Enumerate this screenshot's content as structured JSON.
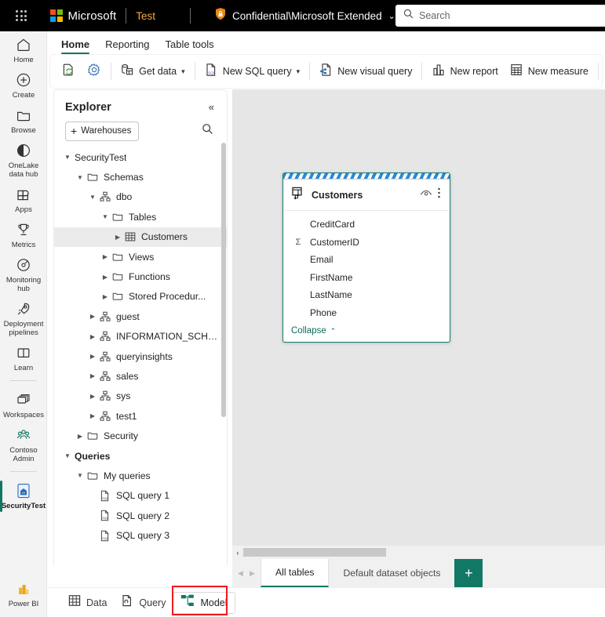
{
  "topbar": {
    "waffle_label": "App launcher",
    "brand": "Microsoft",
    "app_name": "Test",
    "sensitivity_label": "Confidential\\Microsoft Extended",
    "sensitivity_caret": "⌄",
    "search_placeholder": "Search"
  },
  "rail": {
    "items": [
      {
        "label": "Home",
        "icon": "home-icon"
      },
      {
        "label": "Create",
        "icon": "plus-circle-icon"
      },
      {
        "label": "Browse",
        "icon": "folder-icon"
      },
      {
        "label": "OneLake\ndata hub",
        "icon": "onelake-icon"
      },
      {
        "label": "Apps",
        "icon": "apps-icon"
      },
      {
        "label": "Metrics",
        "icon": "trophy-icon"
      },
      {
        "label": "Monitoring\nhub",
        "icon": "monitoring-icon"
      },
      {
        "label": "Deployment\npipelines",
        "icon": "rocket-icon"
      },
      {
        "label": "Learn",
        "icon": "book-icon"
      },
      {
        "label": "Workspaces",
        "icon": "workspaces-icon"
      },
      {
        "label": "Contoso\nAdmin",
        "icon": "people-icon"
      },
      {
        "label": "SecurityTest",
        "icon": "warehouse-icon"
      }
    ],
    "selected": "SecurityTest",
    "footer": {
      "label": "Power BI",
      "icon": "powerbi-icon"
    }
  },
  "ribbon": {
    "tabs": [
      {
        "label": "Home",
        "active": true
      },
      {
        "label": "Reporting",
        "active": false
      },
      {
        "label": "Table tools",
        "active": false
      }
    ],
    "buttons": [
      {
        "label": "",
        "icon": "refresh-page-icon",
        "caret": false
      },
      {
        "label": "",
        "icon": "gear-icon",
        "caret": false
      },
      {
        "label": "Get data",
        "icon": "get-data-icon",
        "caret": true
      },
      {
        "label": "New SQL query",
        "icon": "sql-file-icon",
        "caret": true
      },
      {
        "label": "New visual query",
        "icon": "visual-query-icon",
        "caret": false
      },
      {
        "label": "New report",
        "icon": "report-chart-icon",
        "caret": false
      },
      {
        "label": "New measure",
        "icon": "measure-calculator-icon",
        "caret": false
      }
    ]
  },
  "explorer": {
    "title": "Explorer",
    "collapse_icon": "«",
    "warehouses_button": "Warehouses",
    "warehouses_plus": "+",
    "search_icon": "search-icon",
    "tree": [
      {
        "label": "SecurityTest",
        "indent": 0,
        "chevron": "down",
        "icon": "none",
        "bold": false,
        "selected": false
      },
      {
        "label": "Schemas",
        "indent": 1,
        "chevron": "down",
        "icon": "folder",
        "bold": false,
        "selected": false
      },
      {
        "label": "dbo",
        "indent": 2,
        "chevron": "down",
        "icon": "schema",
        "bold": false,
        "selected": false
      },
      {
        "label": "Tables",
        "indent": 3,
        "chevron": "down",
        "icon": "folder",
        "bold": false,
        "selected": false
      },
      {
        "label": "Customers",
        "indent": 4,
        "chevron": "right",
        "icon": "table",
        "bold": false,
        "selected": true
      },
      {
        "label": "Views",
        "indent": 3,
        "chevron": "right",
        "icon": "folder",
        "bold": false,
        "selected": false
      },
      {
        "label": "Functions",
        "indent": 3,
        "chevron": "right",
        "icon": "folder",
        "bold": false,
        "selected": false
      },
      {
        "label": "Stored Procedur...",
        "indent": 3,
        "chevron": "right",
        "icon": "folder",
        "bold": false,
        "selected": false
      },
      {
        "label": "guest",
        "indent": 2,
        "chevron": "right",
        "icon": "schema",
        "bold": false,
        "selected": false
      },
      {
        "label": "INFORMATION_SCHE...",
        "indent": 2,
        "chevron": "right",
        "icon": "schema",
        "bold": false,
        "selected": false
      },
      {
        "label": "queryinsights",
        "indent": 2,
        "chevron": "right",
        "icon": "schema",
        "bold": false,
        "selected": false
      },
      {
        "label": "sales",
        "indent": 2,
        "chevron": "right",
        "icon": "schema",
        "bold": false,
        "selected": false
      },
      {
        "label": "sys",
        "indent": 2,
        "chevron": "right",
        "icon": "schema",
        "bold": false,
        "selected": false
      },
      {
        "label": "test1",
        "indent": 2,
        "chevron": "right",
        "icon": "schema",
        "bold": false,
        "selected": false
      },
      {
        "label": "Security",
        "indent": 1,
        "chevron": "right",
        "icon": "folder",
        "bold": false,
        "selected": false
      },
      {
        "label": "Queries",
        "indent": 0,
        "chevron": "down",
        "icon": "none",
        "bold": true,
        "selected": false
      },
      {
        "label": "My queries",
        "indent": 1,
        "chevron": "down",
        "icon": "folder",
        "bold": false,
        "selected": false
      },
      {
        "label": "SQL query 1",
        "indent": 2,
        "chevron": "none",
        "icon": "sqlfile",
        "bold": false,
        "selected": false
      },
      {
        "label": "SQL query 2",
        "indent": 2,
        "chevron": "none",
        "icon": "sqlfile",
        "bold": false,
        "selected": false
      },
      {
        "label": "SQL query 3",
        "indent": 2,
        "chevron": "none",
        "icon": "sqlfile",
        "bold": false,
        "selected": false
      }
    ]
  },
  "canvas": {
    "table_card": {
      "title": "Customers",
      "table_icon": "table-sort-icon",
      "hide_icon": "eye-icon",
      "more_icon": "more-vertical-icon",
      "fields": [
        {
          "name": "CreditCard",
          "aggregate": false
        },
        {
          "name": "CustomerID",
          "aggregate": true
        },
        {
          "name": "Email",
          "aggregate": false
        },
        {
          "name": "FirstName",
          "aggregate": false
        },
        {
          "name": "LastName",
          "aggregate": false
        },
        {
          "name": "Phone",
          "aggregate": false
        }
      ],
      "collapse_label": "Collapse",
      "collapse_caret": "⌃",
      "sigma_glyph": "Σ"
    },
    "hscroll_left_arrow": "‹",
    "tabs": [
      {
        "label": "All tables",
        "active": true
      },
      {
        "label": "Default dataset objects",
        "active": false
      }
    ],
    "add_tab": "+",
    "nav_prev": "◀",
    "nav_next": "▶"
  },
  "statusbar": {
    "buttons": [
      {
        "label": "Data",
        "icon": "grid-icon",
        "current": false
      },
      {
        "label": "Query",
        "icon": "query-icon",
        "current": false
      },
      {
        "label": "Model",
        "icon": "model-icon",
        "current": true
      }
    ]
  },
  "colors": {
    "accent_green": "#117865",
    "brand_orange": "#f2a93b",
    "highlight_red": "#f01c1c",
    "grip_blue": "#2b88d8",
    "card_border_green": "#0f7b6c"
  }
}
